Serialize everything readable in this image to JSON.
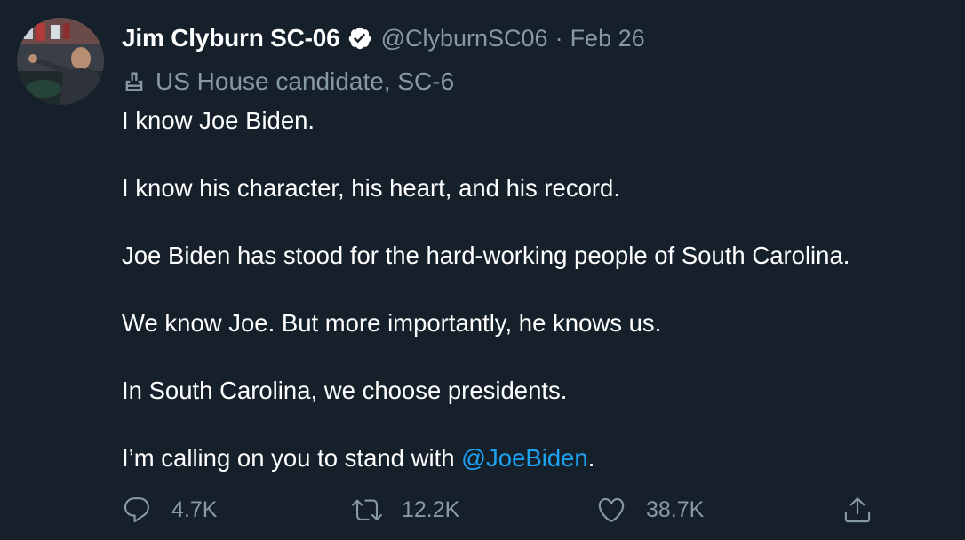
{
  "tweet": {
    "author": {
      "display_name": "Jim Clyburn SC-06",
      "handle": "@ClyburnSC06",
      "verified": true
    },
    "separator": "·",
    "date": "Feb 26",
    "label": {
      "icon": "ballot-box-icon",
      "text": "US House candidate, SC-6"
    },
    "body": {
      "line1": "I know Joe Biden.",
      "line2": "I know his character, his heart, and his record.",
      "line3": "Joe Biden has stood for the hard-working people of South Carolina.",
      "line4": "We know Joe. But more importantly, he knows us.",
      "line5": "In South Carolina, we choose presidents.",
      "line6_prefix": "I’m calling on you to stand with ",
      "line6_mention": "@JoeBiden",
      "line6_suffix": "."
    },
    "actions": {
      "reply": {
        "icon": "reply-icon",
        "count": "4.7K"
      },
      "retweet": {
        "icon": "retweet-icon",
        "count": "12.2K"
      },
      "like": {
        "icon": "heart-icon",
        "count": "38.7K"
      },
      "share": {
        "icon": "share-icon"
      }
    }
  },
  "colors": {
    "background": "#15202b",
    "text_primary": "#ffffff",
    "text_secondary": "#8899a6",
    "accent": "#1da1f2"
  }
}
